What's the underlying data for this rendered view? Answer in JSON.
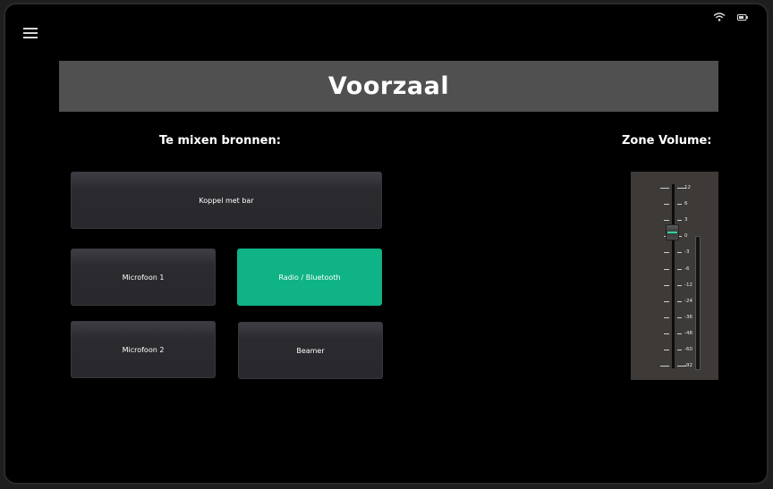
{
  "header": {
    "title": "Voorzaal"
  },
  "sections": {
    "sources_label": "Te mixen bronnen:",
    "volume_label": "Zone Volume:"
  },
  "sources": {
    "koppel": "Koppel met bar",
    "mic1": "Microfoon 1",
    "radio": "Radio / Bluetooth",
    "mic2": "Microfoon 2",
    "beamer": "Beamer"
  },
  "active_source": "Radio / Bluetooth",
  "fader": {
    "scale": [
      "12",
      "6",
      "3",
      "0",
      "-3",
      "-6",
      "-12",
      "-24",
      "-36",
      "-48",
      "-60",
      "-92"
    ],
    "level_db": "0"
  },
  "colors": {
    "accent": "#0fb385",
    "title_bar": "#505050",
    "panel": "#3d3a38"
  },
  "icons": {
    "menu": "hamburger-menu-icon",
    "wifi": "wifi-icon",
    "battery": "battery-icon"
  }
}
